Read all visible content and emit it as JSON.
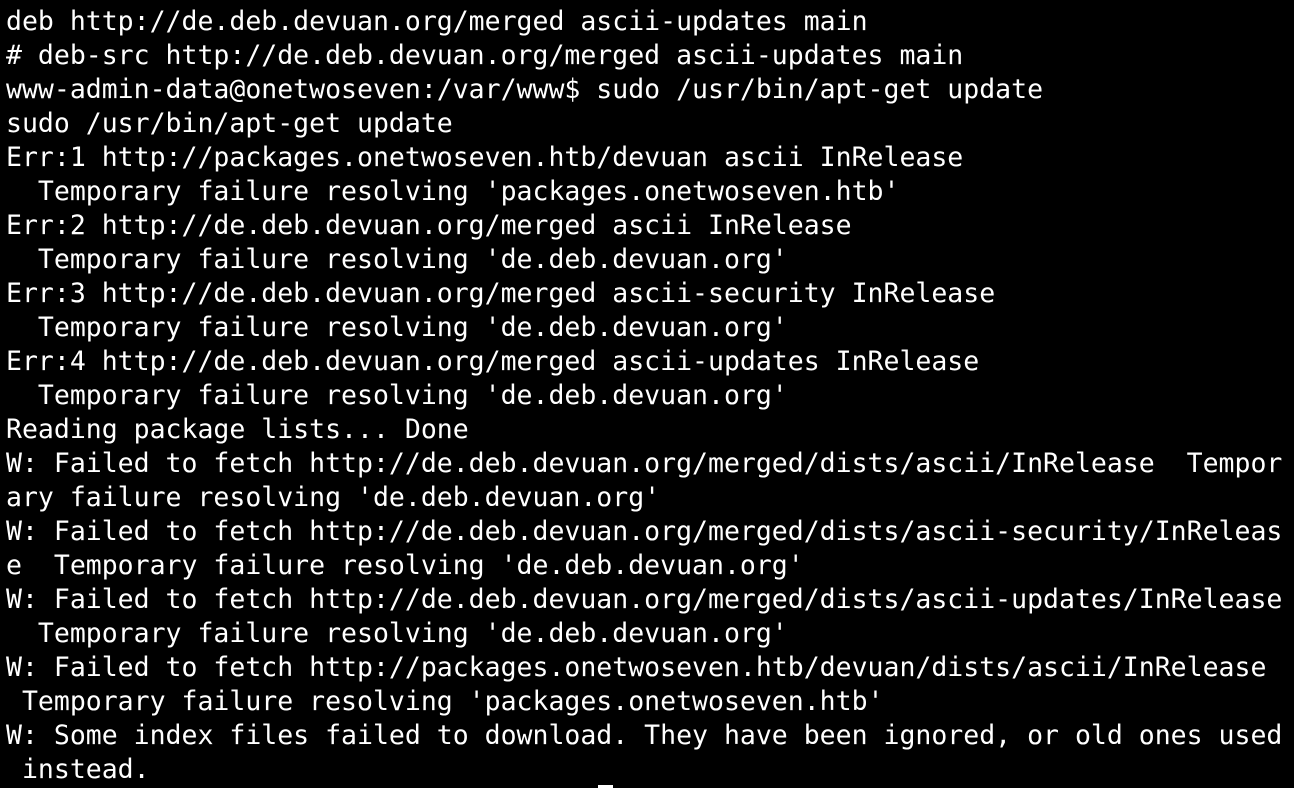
{
  "terminal": {
    "colors": {
      "background": "#000000",
      "foreground": "#ffffff"
    },
    "lines": [
      "deb http://de.deb.devuan.org/merged ascii-updates main",
      "# deb-src http://de.deb.devuan.org/merged ascii-updates main",
      "www-admin-data@onetwoseven:/var/www$ sudo /usr/bin/apt-get update",
      "sudo /usr/bin/apt-get update",
      "Err:1 http://packages.onetwoseven.htb/devuan ascii InRelease",
      "  Temporary failure resolving 'packages.onetwoseven.htb'",
      "Err:2 http://de.deb.devuan.org/merged ascii InRelease",
      "  Temporary failure resolving 'de.deb.devuan.org'",
      "Err:3 http://de.deb.devuan.org/merged ascii-security InRelease",
      "  Temporary failure resolving 'de.deb.devuan.org'",
      "Err:4 http://de.deb.devuan.org/merged ascii-updates InRelease",
      "  Temporary failure resolving 'de.deb.devuan.org'",
      "Reading package lists... Done",
      "W: Failed to fetch http://de.deb.devuan.org/merged/dists/ascii/InRelease  Tempor",
      "ary failure resolving 'de.deb.devuan.org'",
      "W: Failed to fetch http://de.deb.devuan.org/merged/dists/ascii-security/InReleas",
      "e  Temporary failure resolving 'de.deb.devuan.org'",
      "W: Failed to fetch http://de.deb.devuan.org/merged/dists/ascii-updates/InRelease",
      "  Temporary failure resolving 'de.deb.devuan.org'",
      "W: Failed to fetch http://packages.onetwoseven.htb/devuan/dists/ascii/InRelease",
      " Temporary failure resolving 'packages.onetwoseven.htb'",
      "W: Some index files failed to download. They have been ignored, or old ones used",
      " instead."
    ]
  }
}
